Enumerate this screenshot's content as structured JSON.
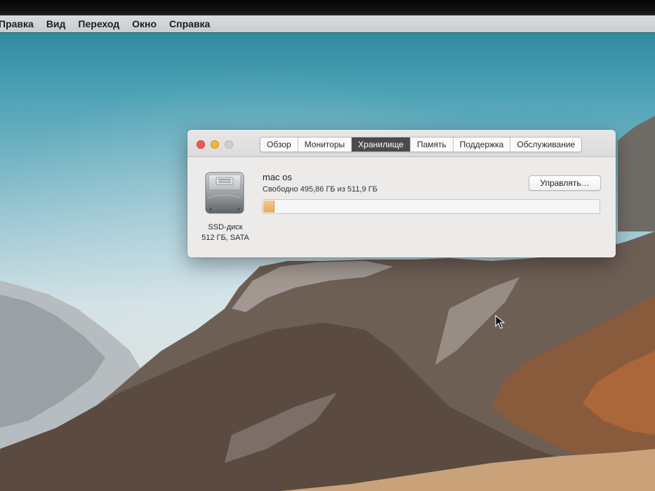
{
  "menubar": {
    "items": [
      "Правка",
      "Вид",
      "Переход",
      "Окно",
      "Справка"
    ]
  },
  "window": {
    "tabs": [
      {
        "label": "Обзор",
        "active": false
      },
      {
        "label": "Мониторы",
        "active": false
      },
      {
        "label": "Хранилище",
        "active": true
      },
      {
        "label": "Память",
        "active": false
      },
      {
        "label": "Поддержка",
        "active": false
      },
      {
        "label": "Обслуживание",
        "active": false
      }
    ],
    "disk": {
      "icon": "hard-drive-icon",
      "type": "SSD-диск",
      "spec": "512 ГБ, SATA"
    },
    "volume": {
      "name": "mac os",
      "free_text": "Свободно 495,86 ГБ из 511,9 ГБ",
      "used_fraction": 0.031
    },
    "manage_button": "Управлять…"
  },
  "colors": {
    "active_tab": "#4b4b4b",
    "usage_fill": "#e9a95d",
    "close": "#ec5a51",
    "minimize": "#f1b43a"
  }
}
